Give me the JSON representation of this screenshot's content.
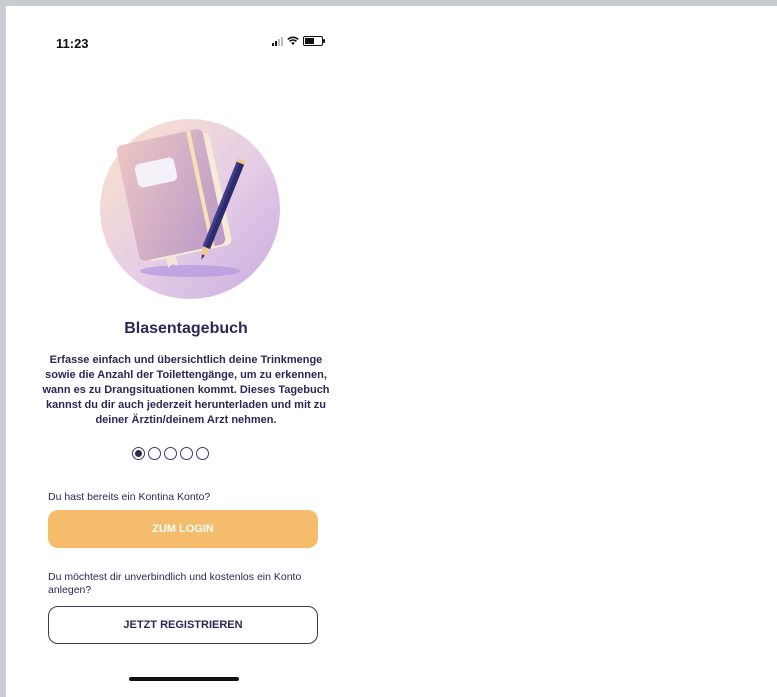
{
  "status_bar": {
    "time": "11:23"
  },
  "onboarding": {
    "title": "Blasentagebuch",
    "description": "Erfasse einfach und übersichtlich deine Trinkmenge sowie die Anzahl der Toilettengänge, um zu erkennen, wann es zu Drangsituationen kommt. Dieses Tagebuch kannst du dir auch jederzeit herunterladen und mit zu deiner Ärztin/deinem Arzt nehmen.",
    "page_indicator": {
      "current": 1,
      "total": 5
    }
  },
  "login": {
    "question": "Du hast bereits ein Kontina Konto?",
    "button_label": "ZUM LOGIN"
  },
  "register": {
    "question": "Du möchtest dir unverbindlich und kostenlos ein Konto anlegen?",
    "button_label": "JETZT REGISTRIEREN"
  },
  "colors": {
    "primary_text": "#2d2756",
    "login_button": "#f5bc6c",
    "hero_circle": "#d9c7ea"
  },
  "icons": [
    "signal-icon",
    "wifi-icon",
    "battery-icon",
    "notebook-pen-illustration"
  ]
}
